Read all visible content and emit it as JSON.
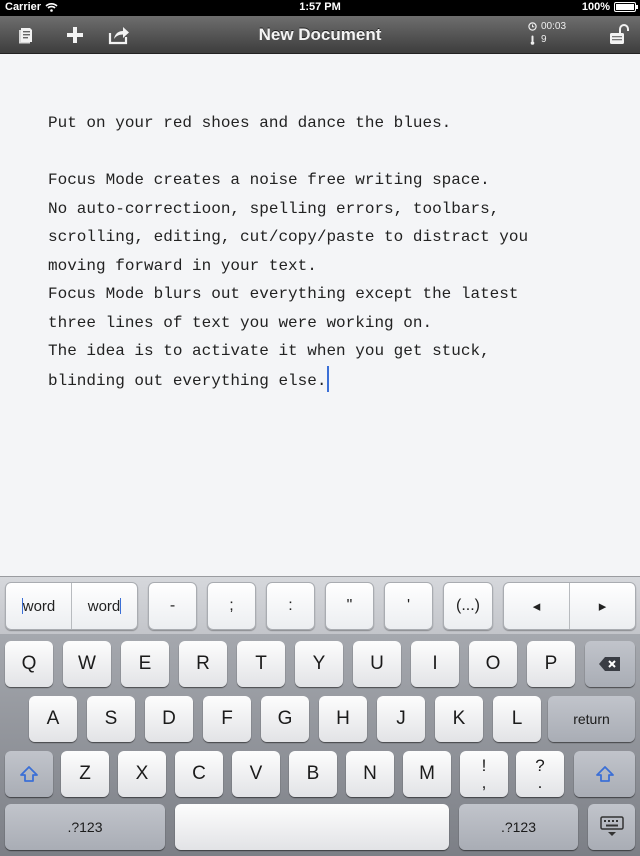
{
  "status_bar": {
    "carrier": "Carrier",
    "time": "1:57 PM",
    "battery": "100%"
  },
  "toolbar": {
    "title": "New Document",
    "timer": "00:03",
    "word_count": "9",
    "icons": [
      "documents-icon",
      "plus-icon",
      "share-icon",
      "focus-lock-icon"
    ]
  },
  "document": {
    "lines": [
      "Put on your red shoes and dance the blues.",
      "",
      "Focus Mode creates a noise free writing space.",
      "No auto-correctioon, spelling errors, toolbars,",
      "scrolling, editing, cut/copy/paste to distract you",
      "moving forward in your text.",
      "Focus Mode blurs out everything except the latest",
      "three lines of text you were working on.",
      "The idea is to activate it when you get stuck,",
      "blinding out everything else."
    ]
  },
  "extra_row": {
    "word_left": "word",
    "word_right": "word",
    "keys": [
      "-",
      ";",
      ":",
      "\"",
      "'",
      "(...)"
    ],
    "arrow_left": "◂",
    "arrow_right": "▸"
  },
  "keyboard": {
    "row1": [
      "Q",
      "W",
      "E",
      "R",
      "T",
      "Y",
      "U",
      "I",
      "O",
      "P"
    ],
    "row2": [
      "A",
      "S",
      "D",
      "F",
      "G",
      "H",
      "J",
      "K",
      "L"
    ],
    "return_label": "return",
    "row3": [
      "Z",
      "X",
      "C",
      "V",
      "B",
      "N",
      "M"
    ],
    "punct1": [
      "!",
      ","
    ],
    "punct2": [
      "?",
      "."
    ],
    "numbers_label": ".?123"
  }
}
